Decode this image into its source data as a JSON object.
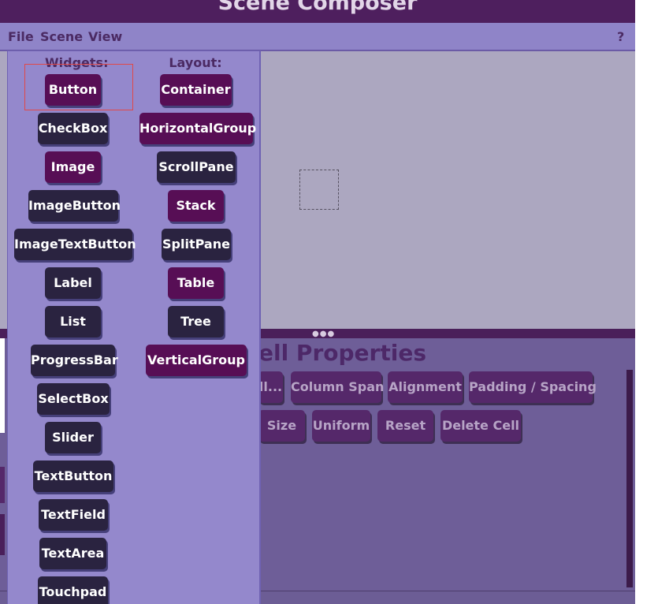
{
  "window": {
    "title": "Scene Composer"
  },
  "menu": {
    "file": "File",
    "scene": "Scene",
    "view": "View",
    "help": "?"
  },
  "cell_properties": {
    "title": "ell Properties",
    "row1": [
      "ll...",
      "Column Span",
      "Alignment",
      "Padding / Spacing"
    ],
    "row2": [
      "Size",
      "Uniform",
      "Reset",
      "Delete Cell"
    ]
  },
  "widgets_popup": {
    "widgets_header": "Widgets:",
    "layout_header": "Layout:",
    "widgets": [
      "Button",
      "CheckBox",
      "Image",
      "ImageButton",
      "ImageTextButton",
      "Label",
      "List",
      "ProgressBar",
      "SelectBox",
      "Slider",
      "TextButton",
      "TextField",
      "TextArea",
      "Touchpad"
    ],
    "layouts": [
      "Container",
      "HorizontalGroup",
      "ScrollPane",
      "Stack",
      "SplitPane",
      "Table",
      "Tree",
      "VerticalGroup"
    ],
    "selected_widget": "Button"
  },
  "colors": {
    "title_bar": "#4e1f5e",
    "menu_bar": "#8f84c8",
    "popup_bg": "#9488cc",
    "dark_button": "#2a2340",
    "purple_button": "#570e55",
    "canvas": "#aca7c0",
    "selection_outline": "#e04848"
  }
}
